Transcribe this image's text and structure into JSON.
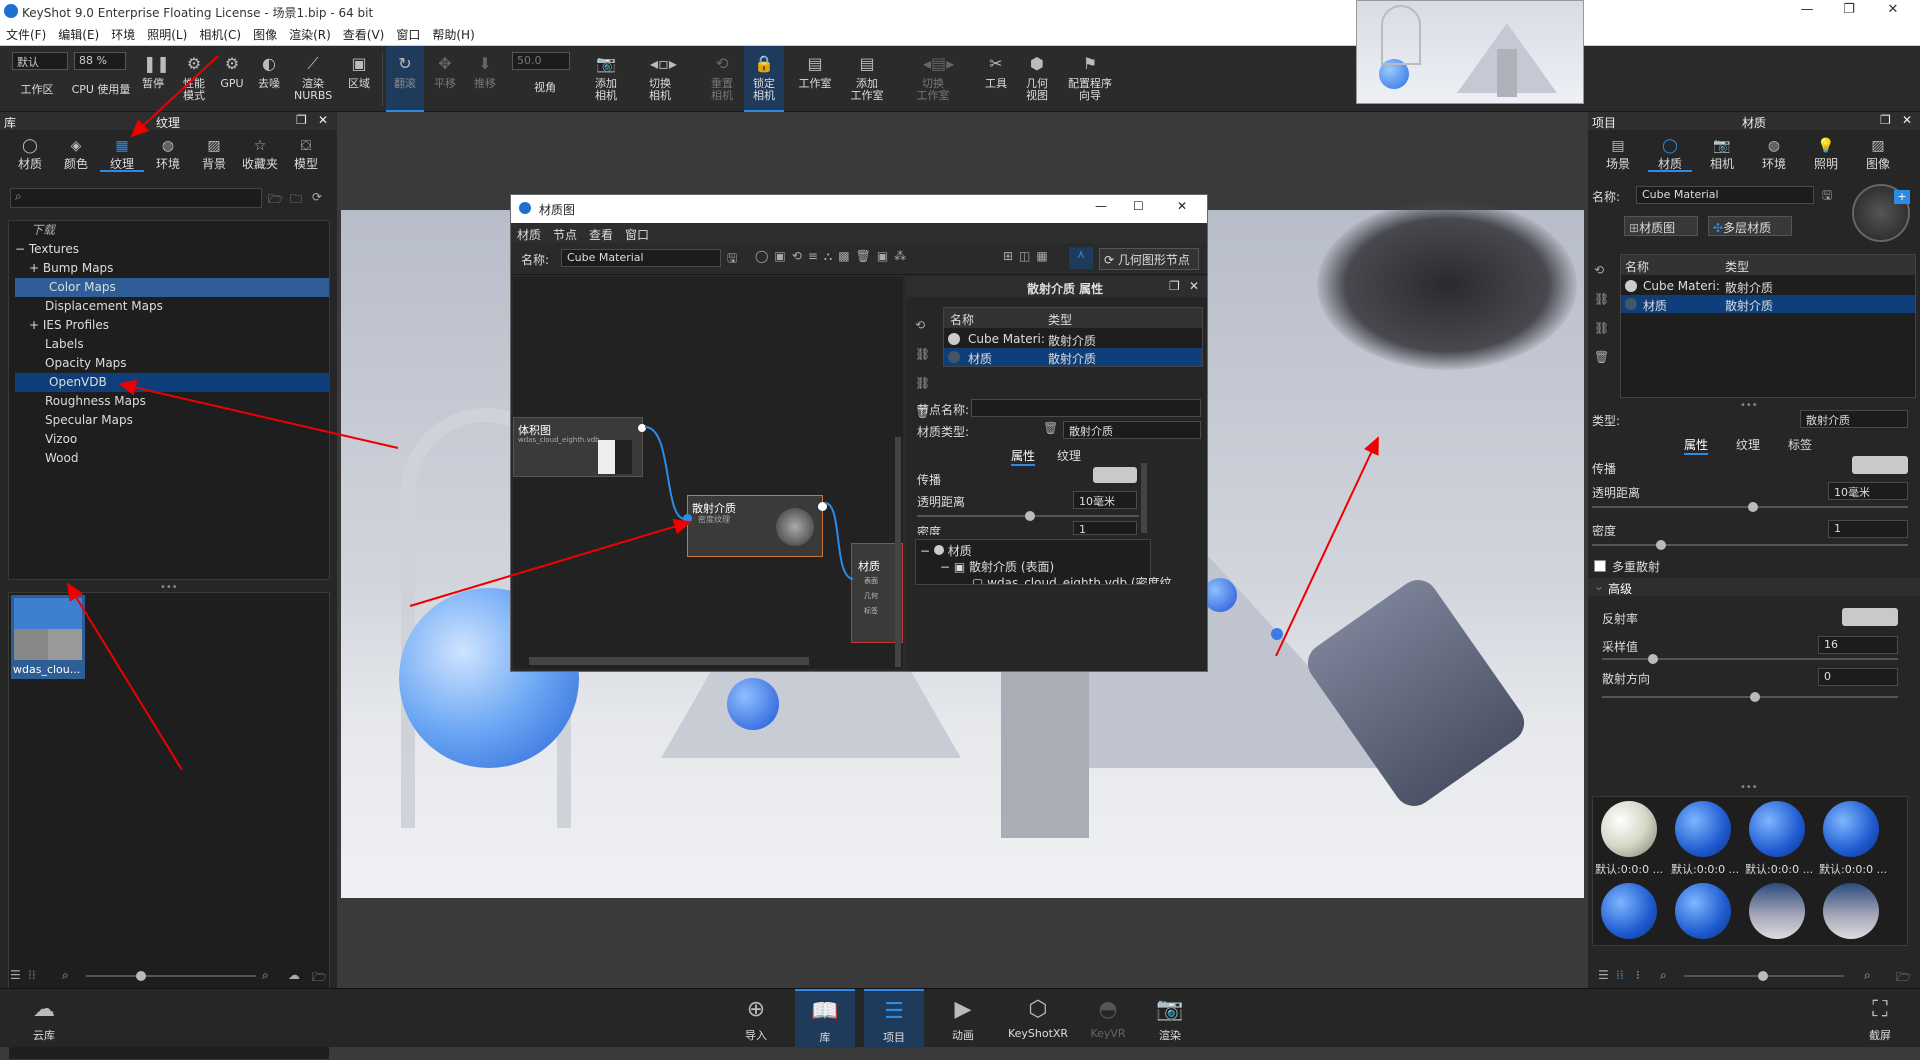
{
  "window": {
    "title": "KeyShot 9.0 Enterprise Floating License - 场景1.bip - 64 bit",
    "min": "—",
    "max": "❐",
    "close": "✕"
  },
  "menu": [
    "文件(F)",
    "编辑(E)",
    "环境",
    "照明(L)",
    "相机(C)",
    "图像",
    "渲染(R)",
    "查看(V)",
    "窗口",
    "帮助(H)"
  ],
  "toolbar": {
    "preset_value": "默认",
    "zoom_value": "88 %",
    "fps_value": "50.0",
    "items": [
      {
        "label": "工作区",
        "icon": "workspace-icon"
      },
      {
        "label": "CPU 使用量",
        "icon": "cpu-icon"
      },
      {
        "label": "暂停",
        "icon": "pause-icon"
      },
      {
        "label": "性能\n模式",
        "icon": "performance-icon"
      },
      {
        "label": "GPU",
        "icon": "gpu-icon"
      },
      {
        "label": "去噪",
        "icon": "denoise-icon"
      },
      {
        "label": "渲染\nNURBS",
        "icon": "nurbs-icon"
      },
      {
        "label": "区域",
        "icon": "region-icon"
      },
      {
        "label": "翻滚",
        "icon": "tumble-icon"
      },
      {
        "label": "平移",
        "icon": "pan-icon"
      },
      {
        "label": "推移",
        "icon": "dolly-icon"
      },
      {
        "label": "视角",
        "icon": "view-angle-icon"
      },
      {
        "label": "添加\n相机",
        "icon": "add-camera-icon"
      },
      {
        "label": "切换\n相机",
        "icon": "switch-camera-icon"
      },
      {
        "label": "重置\n相机",
        "icon": "reset-camera-icon"
      },
      {
        "label": "锁定\n相机",
        "icon": "lock-camera-icon"
      },
      {
        "label": "工作室",
        "icon": "studio-icon"
      },
      {
        "label": "添加\n工作室",
        "icon": "add-studio-icon"
      },
      {
        "label": "切换\n工作室",
        "icon": "switch-studio-icon"
      },
      {
        "label": "工具",
        "icon": "tools-icon"
      },
      {
        "label": "几何\n视图",
        "icon": "geometry-view-icon"
      },
      {
        "label": "配置程序\n向导",
        "icon": "configurator-icon"
      }
    ]
  },
  "library": {
    "title": "库",
    "subtitle": "纹理",
    "tabs": [
      "材质",
      "颜色",
      "纹理",
      "环境",
      "背景",
      "收藏夹",
      "模型"
    ],
    "search_placeholder": "",
    "tree": [
      "下载",
      "Textures",
      "Bump Maps",
      "Color Maps",
      "Displacement Maps",
      "IES Profiles",
      "Labels",
      "Opacity Maps",
      "OpenVDB",
      "Roughness Maps",
      "Specular Maps",
      "Vizoo",
      "Wood"
    ],
    "thumb_label": "wdas_clou..."
  },
  "material_graph": {
    "title": "材质图",
    "menu": [
      "材质",
      "节点",
      "查看",
      "窗口"
    ],
    "name_label": "名称:",
    "name_value": "Cube Material",
    "geom_button": "几何图形节点",
    "node_volume": {
      "title": "体积图",
      "sub": "wdas_cloud_eighth.vdb"
    },
    "node_scatter": {
      "title": "散射介质",
      "sub": "密度纹理"
    },
    "node_material": {
      "title": "材质",
      "ports": [
        "表面",
        "几何",
        "标签"
      ]
    },
    "props": {
      "title": "散射介质 属性",
      "col_name": "名称",
      "col_type": "类型",
      "rows": [
        [
          "Cube Materi:",
          "散射介质"
        ],
        [
          "材质",
          "散射介质"
        ]
      ],
      "node_name_label": "节点名称:",
      "mat_type_label": "材质类型:",
      "mat_type_value": "散射介质",
      "tab_props": "属性",
      "tab_texture": "纹理",
      "transmit": "传播",
      "trans_dist": "透明距离",
      "trans_dist_value": "10毫米",
      "density": "密度",
      "density_value": "1",
      "tree": [
        "材质",
        "散射介质 (表面)",
        "wdas_cloud_eighth.vdb (密度纹"
      ]
    }
  },
  "project": {
    "title": "项目",
    "subtitle": "材质",
    "tabs": [
      "场景",
      "材质",
      "相机",
      "环境",
      "照明",
      "图像"
    ],
    "name_label": "名称:",
    "name_value": "Cube Material",
    "btn_graph": "材质图",
    "btn_multi": "多层材质",
    "col_name": "名称",
    "col_type": "类型",
    "rows": [
      [
        "Cube Materi:",
        "散射介质"
      ],
      [
        "材质",
        "散射介质"
      ]
    ],
    "type_label": "类型:",
    "type_value": "散射介质",
    "tabs2": [
      "属性",
      "纹理",
      "标签"
    ],
    "transmit": "传播",
    "trans_dist": "透明距离",
    "trans_dist_value": "10毫米",
    "density": "密度",
    "density_value": "1",
    "multi_scatter": "多重散射",
    "advanced": "高级",
    "albedo": "反射率",
    "samples": "采样值",
    "samples_value": "16",
    "direction": "散射方向",
    "direction_value": "0",
    "swatches": [
      "默认:0:0:0 ...",
      "默认:0:0:0 ...",
      "默认:0:0:0 ...",
      "默认:0:0:0 ..."
    ]
  },
  "bottom": [
    {
      "label": "云库",
      "icon": "cloud-library-icon"
    },
    {
      "label": "导入",
      "icon": "import-icon"
    },
    {
      "label": "库",
      "icon": "library-icon"
    },
    {
      "label": "项目",
      "icon": "project-icon"
    },
    {
      "label": "动画",
      "icon": "animation-icon"
    },
    {
      "label": "KeyShotXR",
      "icon": "keyshotxr-icon"
    },
    {
      "label": "KeyVR",
      "icon": "keyvr-icon"
    },
    {
      "label": "渲染",
      "icon": "render-icon"
    },
    {
      "label": "截屏",
      "icon": "screenshot-icon"
    }
  ]
}
